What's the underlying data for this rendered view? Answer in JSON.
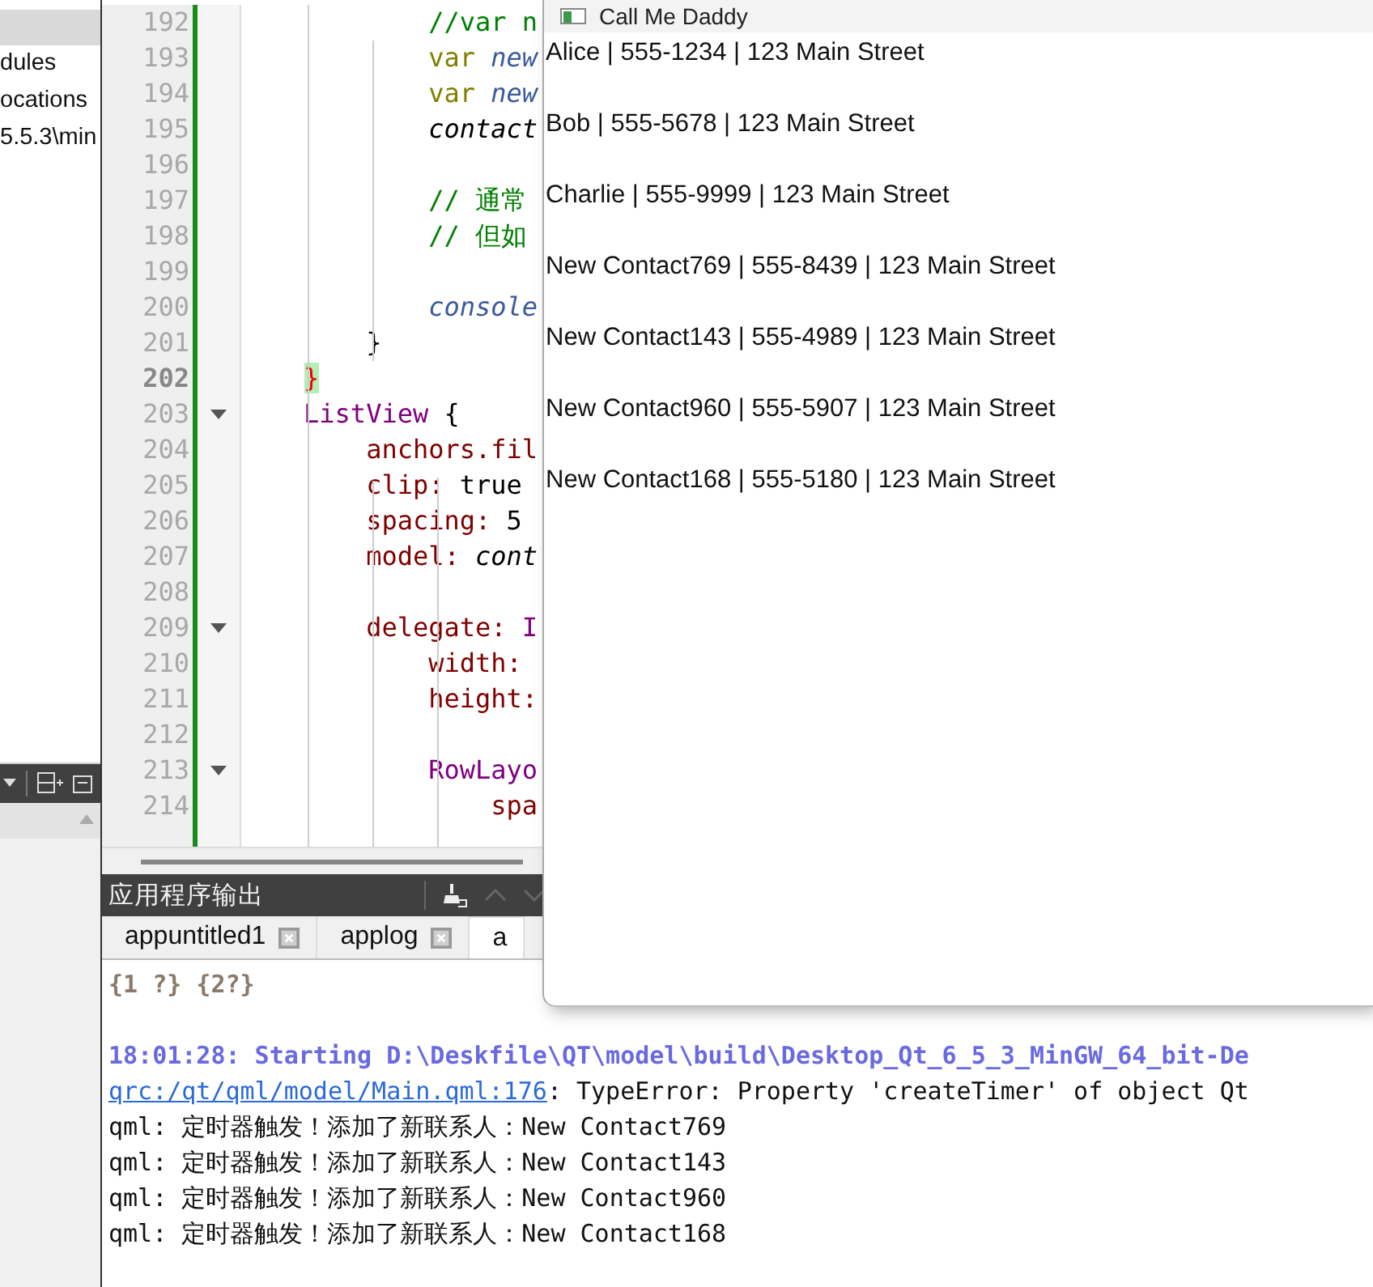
{
  "sidebar": {
    "items": [
      {
        "selected": true
      },
      {
        "label": "dules",
        "selected": false
      },
      {
        "label": "ocations",
        "selected": false
      },
      {
        "label": "5.5.3\\min",
        "selected": false
      }
    ]
  },
  "editor": {
    "lines": [
      {
        "number": "192",
        "current": false,
        "fold": false,
        "segments": [
          {
            "text": "            //var n",
            "kind": "comment"
          }
        ]
      },
      {
        "number": "193",
        "current": false,
        "fold": false,
        "segments": [
          {
            "text": "            var ",
            "kind": "keyword"
          },
          {
            "text": "new",
            "kind": "variable"
          }
        ]
      },
      {
        "number": "194",
        "current": false,
        "fold": false,
        "segments": [
          {
            "text": "            var ",
            "kind": "keyword"
          },
          {
            "text": "new",
            "kind": "variable"
          }
        ]
      },
      {
        "number": "195",
        "current": false,
        "fold": false,
        "segments": [
          {
            "text": "            contact",
            "kind": "object"
          }
        ]
      },
      {
        "number": "196",
        "current": false,
        "fold": false
      },
      {
        "number": "197",
        "current": false,
        "fold": false,
        "segments": [
          {
            "text": "            // 通常",
            "kind": "comment"
          }
        ]
      },
      {
        "number": "198",
        "current": false,
        "fold": false,
        "segments": [
          {
            "text": "            // 但如",
            "kind": "comment"
          }
        ]
      },
      {
        "number": "199",
        "current": false,
        "fold": false
      },
      {
        "number": "200",
        "current": false,
        "fold": false,
        "segments": [
          {
            "text": "            console",
            "kind": "variable"
          }
        ]
      },
      {
        "number": "201",
        "current": false,
        "fold": false,
        "segments": [
          {
            "text": "        }",
            "kind": "plain"
          }
        ]
      },
      {
        "number": "202",
        "current": true,
        "fold": false,
        "segments": [
          {
            "text": "    }",
            "kind": "match"
          }
        ]
      },
      {
        "number": "203",
        "current": false,
        "fold": true,
        "segments": [
          {
            "text": "    ListView",
            "kind": "type"
          },
          {
            "text": " {",
            "kind": "plain"
          }
        ]
      },
      {
        "number": "204",
        "current": false,
        "fold": false,
        "segments": [
          {
            "text": "        anchors.fil",
            "kind": "property"
          }
        ]
      },
      {
        "number": "205",
        "current": false,
        "fold": false,
        "segments": [
          {
            "text": "        clip:",
            "kind": "property"
          },
          {
            "text": " true",
            "kind": "plain"
          }
        ]
      },
      {
        "number": "206",
        "current": false,
        "fold": false,
        "segments": [
          {
            "text": "        spacing:",
            "kind": "property"
          },
          {
            "text": " 5",
            "kind": "plain"
          }
        ]
      },
      {
        "number": "207",
        "current": false,
        "fold": false,
        "segments": [
          {
            "text": "        model:",
            "kind": "property"
          },
          {
            "text": " cont",
            "kind": "object"
          }
        ]
      },
      {
        "number": "208",
        "current": false,
        "fold": false
      },
      {
        "number": "209",
        "current": false,
        "fold": true,
        "segments": [
          {
            "text": "        delegate:",
            "kind": "property"
          },
          {
            "text": " I",
            "kind": "type"
          }
        ]
      },
      {
        "number": "210",
        "current": false,
        "fold": false,
        "segments": [
          {
            "text": "            width:",
            "kind": "property"
          }
        ]
      },
      {
        "number": "211",
        "current": false,
        "fold": false,
        "segments": [
          {
            "text": "            height:",
            "kind": "property"
          }
        ]
      },
      {
        "number": "212",
        "current": false,
        "fold": false
      },
      {
        "number": "213",
        "current": false,
        "fold": true,
        "segments": [
          {
            "text": "            RowLayo",
            "kind": "type"
          }
        ]
      },
      {
        "number": "214",
        "current": false,
        "fold": false,
        "segments": [
          {
            "text": "                spa",
            "kind": "property"
          }
        ]
      }
    ]
  },
  "output": {
    "title": "应用程序输出",
    "tabs": [
      {
        "label": "appuntitled1",
        "selected": false,
        "closable": true
      },
      {
        "label": "applog",
        "selected": false,
        "closable": true
      },
      {
        "label": "a",
        "selected": true,
        "closable": false
      }
    ],
    "lines": [
      {
        "kind": "muted",
        "text": "{1 ?} {2?}"
      },
      {
        "kind": "blank"
      },
      {
        "kind": "start",
        "text": "18:01:28: Starting D:\\Deskfile\\QT\\model\\build\\Desktop_Qt_6_5_3_MinGW_64_bit-De"
      },
      {
        "kind": "error",
        "link": "qrc:/qt/qml/model/Main.qml:176",
        "text": ": TypeError: Property 'createTimer' of object Qt"
      },
      {
        "kind": "plain",
        "text": "qml: 定时器触发！添加了新联系人：New Contact769"
      },
      {
        "kind": "plain",
        "text": "qml: 定时器触发！添加了新联系人：New Contact143"
      },
      {
        "kind": "plain",
        "text": "qml: 定时器触发！添加了新联系人：New Contact960"
      },
      {
        "kind": "plain",
        "text": "qml: 定时器触发！添加了新联系人：New Contact168"
      }
    ]
  },
  "app_window": {
    "title": "Call Me Daddy",
    "contacts": [
      "Alice | 555-1234 | 123 Main Street",
      "Bob | 555-5678 | 123 Main Street",
      "Charlie | 555-9999 | 123 Main Street",
      "New Contact769 | 555-8439 | 123 Main Street",
      "New Contact143 | 555-4989 | 123 Main Street",
      "New Contact960 | 555-5907 | 123 Main Street",
      "New Contact168 | 555-5180 | 123 Main Street"
    ]
  }
}
